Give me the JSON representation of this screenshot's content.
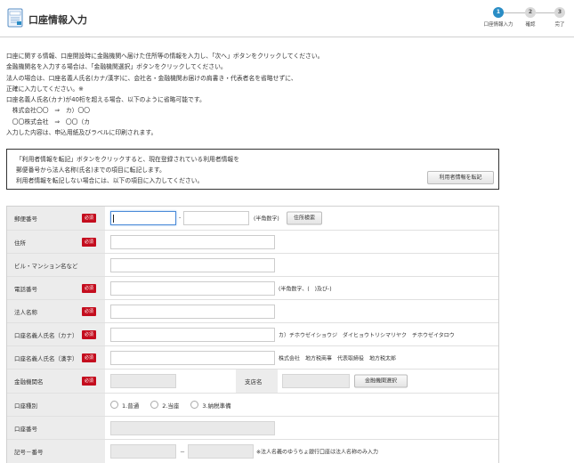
{
  "header": {
    "title": "口座情報入力"
  },
  "steps": [
    {
      "num": "1",
      "label": "口座情報入力",
      "active": true
    },
    {
      "num": "2",
      "label": "確認",
      "active": false
    },
    {
      "num": "3",
      "label": "完了",
      "active": false
    }
  ],
  "intro": [
    "口座に関する情報、口座開設時に金融機関へ届けた住所等の情報を入力し、「次へ」ボタンをクリックしてください。",
    "金融機関名を入力する場合は、「金融機関選択」ボタンをクリックしてください。",
    "法人の場合は、口座名義人氏名(カナ/漢字)に、会社名・金融機関お届けの肩書き・代表者名を省略せずに、",
    "正確に入力してください。※",
    "口座名義人氏名(カナ)が40桁を超える場合、以下のように省略可能です。",
    "　株式会社〇〇　⇒　カ）〇〇",
    "　〇〇株式会社　⇒　〇〇（カ",
    "入力した内容は、申込用紙及びラベルに印刷されます。"
  ],
  "transfer": {
    "lines": [
      "「利用者情報を転記」ボタンをクリックすると、現在登録されている利用者情報を",
      "郵便番号から法人名称(氏名)までの項目に転記します。",
      "利用者情報を転記しない場合には、以下の項目に入力してください。"
    ],
    "button": "利用者情報を転記"
  },
  "required_badge": "必須",
  "form": {
    "postal": {
      "label": "郵便番号",
      "dash": "-",
      "note": "(半角数字)",
      "button": "住所検索"
    },
    "address": {
      "label": "住所"
    },
    "building": {
      "label": "ビル・マンション名など"
    },
    "phone": {
      "label": "電話番号",
      "note": "(半角数字、(　)及び-)"
    },
    "corp_name": {
      "label": "法人名称"
    },
    "holder_kana": {
      "label": "口座名義人氏名（カナ）",
      "example": "カ）チホウゼイショウジ　ダイヒョウトリシマリヤク　チホウゼイタロウ"
    },
    "holder_kanji": {
      "label": "口座名義人氏名（漢字）",
      "example": "株式会社　地方税商事　代表取締役　地方税太郎"
    },
    "bank": {
      "label": "金融機関名",
      "branch_label": "支店名",
      "button": "金融機関選択"
    },
    "account_type": {
      "label": "口座種別",
      "options": [
        "1.普通",
        "2.当座",
        "3.納税準備"
      ]
    },
    "account_number": {
      "label": "口座番号"
    },
    "symbol_number": {
      "label": "記号－番号",
      "dash": "－",
      "note": "※法人名義のゆうちょ銀行口座は法人名称のみ入力"
    }
  }
}
